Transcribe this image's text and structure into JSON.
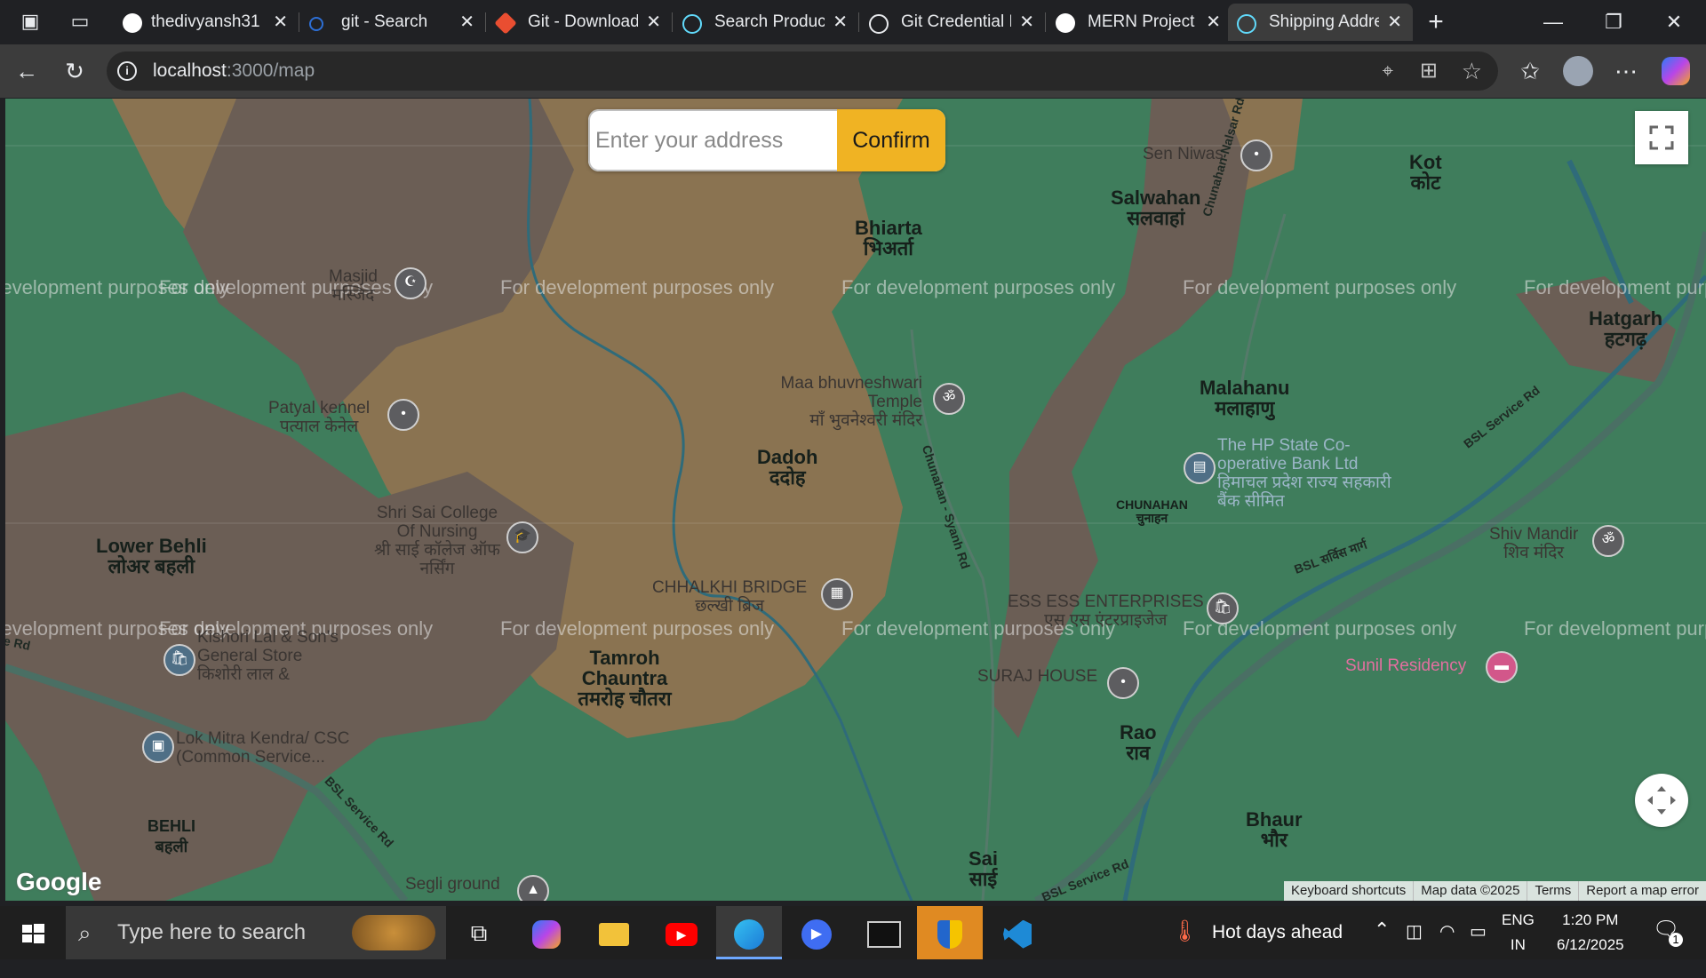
{
  "browser": {
    "tabs": [
      {
        "title": "thedivyansh31",
        "icon": "github-icon",
        "color": "#ffffff"
      },
      {
        "title": "git - Search",
        "icon": "search-icon",
        "color": "#2d6fd6"
      },
      {
        "title": "Git - Downloads",
        "icon": "git-icon",
        "color": "#e94e31"
      },
      {
        "title": "Search Products",
        "icon": "react-icon",
        "color": "#61dafb"
      },
      {
        "title": "Git Credential Manager",
        "icon": "globe-icon",
        "color": "#e8eaed"
      },
      {
        "title": "MERN Project",
        "icon": "openai-icon",
        "color": "#ffffff"
      },
      {
        "title": "Shipping Address",
        "icon": "react-icon",
        "color": "#61dafb"
      }
    ],
    "new_tab_symbol": "+",
    "url_host": "localhost",
    "url_path": ":3000/map"
  },
  "map": {
    "search": {
      "placeholder": "Enter your address",
      "confirm_label": "Confirm"
    },
    "watermark": "For development purposes only",
    "places": [
      {
        "en": "Bhiarta",
        "hi": "भिअर्ता"
      },
      {
        "en": "Salwahan",
        "hi": "सलवाहां"
      },
      {
        "en": "Kot",
        "hi": "कोट"
      },
      {
        "en": "Hatgarh",
        "hi": "हटगढ़"
      },
      {
        "en": "Malahanu",
        "hi": "मलाहाणु"
      },
      {
        "en": "Dadoh",
        "hi": "ददोह"
      },
      {
        "en": "Lower Behli",
        "hi": "लोअर बहली"
      },
      {
        "en": "Tamroh Chauntra",
        "hi": "तमरोह चौतरा"
      },
      {
        "en": "Rao",
        "hi": "राव"
      },
      {
        "en": "Bhaur",
        "hi": "भौर"
      },
      {
        "en": "BEHLI",
        "hi": "बहली"
      },
      {
        "en": "Sai",
        "hi": "साई"
      },
      {
        "en": "CHUNAHAN",
        "hi": "चुनाहन"
      }
    ],
    "pois": [
      {
        "en": "Sen Niwas",
        "hi": ""
      },
      {
        "en": "Masjid",
        "hi": "मस्जिद"
      },
      {
        "en": "Patyal kennel",
        "hi": "पत्याल केनेल"
      },
      {
        "en": "Maa bhuvneshwari Temple",
        "hi": "माँ भुवनेश्वरी मंदिर"
      },
      {
        "en": "The HP State Co-operative Bank Ltd",
        "hi": "हिमाचल प्रदेश राज्य सहकारी बैंक सीमित"
      },
      {
        "en": "Shri Sai College Of Nursing",
        "hi": "श्री साई कॉलेज ऑफ नर्सिंग"
      },
      {
        "en": "CHHALKHI BRIDGE",
        "hi": "छल्खी ब्रिज"
      },
      {
        "en": "Shiv Mandir",
        "hi": "शिव मंदिर"
      },
      {
        "en": "ESS ESS ENTERPRISES",
        "hi": "एस एस एंटरप्राइजेज"
      },
      {
        "en": "Kishori Lal & Son's General Store",
        "hi": "किशोरी लाल &"
      },
      {
        "en": "SURAJ HOUSE",
        "hi": ""
      },
      {
        "en": "Sunil Residency",
        "hi": ""
      },
      {
        "en": "Lok Mitra Kendra/ CSC (Common Service...",
        "hi": ""
      },
      {
        "en": "Segli ground",
        "hi": ""
      }
    ],
    "roads": [
      "Chunahan-Nalsar Rd",
      "Chunahan - Syanh Rd",
      "BSL Service Rd",
      "BSL सर्विस मार्ग",
      "BSL Service Rd",
      "BSL Service Rd",
      "e Rd"
    ],
    "attribution": [
      "Keyboard shortcuts",
      "Map data ©2025",
      "Terms",
      "Report a map error"
    ],
    "logo": "Google",
    "colors": {
      "forest": "#3f7d5c",
      "urban": "#6b5e55",
      "farmland": "#8a7351",
      "river": "#2f6b7a",
      "confirm": "#f0b323"
    }
  },
  "taskbar": {
    "search_placeholder": "Type here to search",
    "weather": "Hot days ahead",
    "lang": "ENG",
    "region": "IN",
    "time": "1:20 PM",
    "date": "6/12/2025",
    "notifications": "1"
  }
}
